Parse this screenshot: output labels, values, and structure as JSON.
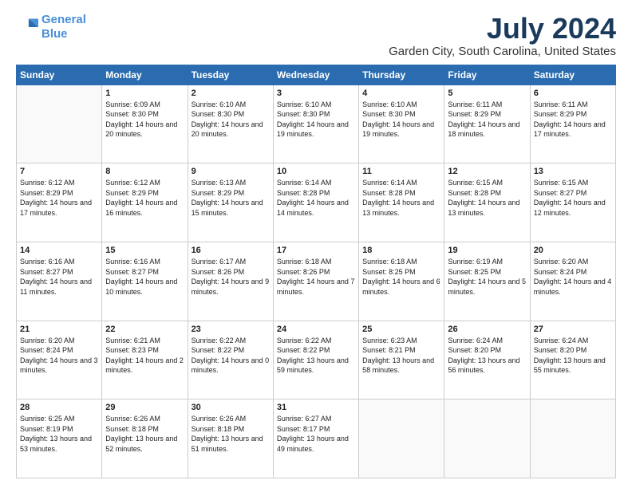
{
  "header": {
    "logo_line1": "General",
    "logo_line2": "Blue",
    "title": "July 2024",
    "subtitle": "Garden City, South Carolina, United States"
  },
  "weekdays": [
    "Sunday",
    "Monday",
    "Tuesday",
    "Wednesday",
    "Thursday",
    "Friday",
    "Saturday"
  ],
  "weeks": [
    [
      {
        "day": "",
        "info": ""
      },
      {
        "day": "1",
        "info": "Sunrise: 6:09 AM\nSunset: 8:30 PM\nDaylight: 14 hours\nand 20 minutes."
      },
      {
        "day": "2",
        "info": "Sunrise: 6:10 AM\nSunset: 8:30 PM\nDaylight: 14 hours\nand 20 minutes."
      },
      {
        "day": "3",
        "info": "Sunrise: 6:10 AM\nSunset: 8:30 PM\nDaylight: 14 hours\nand 19 minutes."
      },
      {
        "day": "4",
        "info": "Sunrise: 6:10 AM\nSunset: 8:30 PM\nDaylight: 14 hours\nand 19 minutes."
      },
      {
        "day": "5",
        "info": "Sunrise: 6:11 AM\nSunset: 8:29 PM\nDaylight: 14 hours\nand 18 minutes."
      },
      {
        "day": "6",
        "info": "Sunrise: 6:11 AM\nSunset: 8:29 PM\nDaylight: 14 hours\nand 17 minutes."
      }
    ],
    [
      {
        "day": "7",
        "info": "Sunrise: 6:12 AM\nSunset: 8:29 PM\nDaylight: 14 hours\nand 17 minutes."
      },
      {
        "day": "8",
        "info": "Sunrise: 6:12 AM\nSunset: 8:29 PM\nDaylight: 14 hours\nand 16 minutes."
      },
      {
        "day": "9",
        "info": "Sunrise: 6:13 AM\nSunset: 8:29 PM\nDaylight: 14 hours\nand 15 minutes."
      },
      {
        "day": "10",
        "info": "Sunrise: 6:14 AM\nSunset: 8:28 PM\nDaylight: 14 hours\nand 14 minutes."
      },
      {
        "day": "11",
        "info": "Sunrise: 6:14 AM\nSunset: 8:28 PM\nDaylight: 14 hours\nand 13 minutes."
      },
      {
        "day": "12",
        "info": "Sunrise: 6:15 AM\nSunset: 8:28 PM\nDaylight: 14 hours\nand 13 minutes."
      },
      {
        "day": "13",
        "info": "Sunrise: 6:15 AM\nSunset: 8:27 PM\nDaylight: 14 hours\nand 12 minutes."
      }
    ],
    [
      {
        "day": "14",
        "info": "Sunrise: 6:16 AM\nSunset: 8:27 PM\nDaylight: 14 hours\nand 11 minutes."
      },
      {
        "day": "15",
        "info": "Sunrise: 6:16 AM\nSunset: 8:27 PM\nDaylight: 14 hours\nand 10 minutes."
      },
      {
        "day": "16",
        "info": "Sunrise: 6:17 AM\nSunset: 8:26 PM\nDaylight: 14 hours\nand 9 minutes."
      },
      {
        "day": "17",
        "info": "Sunrise: 6:18 AM\nSunset: 8:26 PM\nDaylight: 14 hours\nand 7 minutes."
      },
      {
        "day": "18",
        "info": "Sunrise: 6:18 AM\nSunset: 8:25 PM\nDaylight: 14 hours\nand 6 minutes."
      },
      {
        "day": "19",
        "info": "Sunrise: 6:19 AM\nSunset: 8:25 PM\nDaylight: 14 hours\nand 5 minutes."
      },
      {
        "day": "20",
        "info": "Sunrise: 6:20 AM\nSunset: 8:24 PM\nDaylight: 14 hours\nand 4 minutes."
      }
    ],
    [
      {
        "day": "21",
        "info": "Sunrise: 6:20 AM\nSunset: 8:24 PM\nDaylight: 14 hours\nand 3 minutes."
      },
      {
        "day": "22",
        "info": "Sunrise: 6:21 AM\nSunset: 8:23 PM\nDaylight: 14 hours\nand 2 minutes."
      },
      {
        "day": "23",
        "info": "Sunrise: 6:22 AM\nSunset: 8:22 PM\nDaylight: 14 hours\nand 0 minutes."
      },
      {
        "day": "24",
        "info": "Sunrise: 6:22 AM\nSunset: 8:22 PM\nDaylight: 13 hours\nand 59 minutes."
      },
      {
        "day": "25",
        "info": "Sunrise: 6:23 AM\nSunset: 8:21 PM\nDaylight: 13 hours\nand 58 minutes."
      },
      {
        "day": "26",
        "info": "Sunrise: 6:24 AM\nSunset: 8:20 PM\nDaylight: 13 hours\nand 56 minutes."
      },
      {
        "day": "27",
        "info": "Sunrise: 6:24 AM\nSunset: 8:20 PM\nDaylight: 13 hours\nand 55 minutes."
      }
    ],
    [
      {
        "day": "28",
        "info": "Sunrise: 6:25 AM\nSunset: 8:19 PM\nDaylight: 13 hours\nand 53 minutes."
      },
      {
        "day": "29",
        "info": "Sunrise: 6:26 AM\nSunset: 8:18 PM\nDaylight: 13 hours\nand 52 minutes."
      },
      {
        "day": "30",
        "info": "Sunrise: 6:26 AM\nSunset: 8:18 PM\nDaylight: 13 hours\nand 51 minutes."
      },
      {
        "day": "31",
        "info": "Sunrise: 6:27 AM\nSunset: 8:17 PM\nDaylight: 13 hours\nand 49 minutes."
      },
      {
        "day": "",
        "info": ""
      },
      {
        "day": "",
        "info": ""
      },
      {
        "day": "",
        "info": ""
      }
    ]
  ]
}
